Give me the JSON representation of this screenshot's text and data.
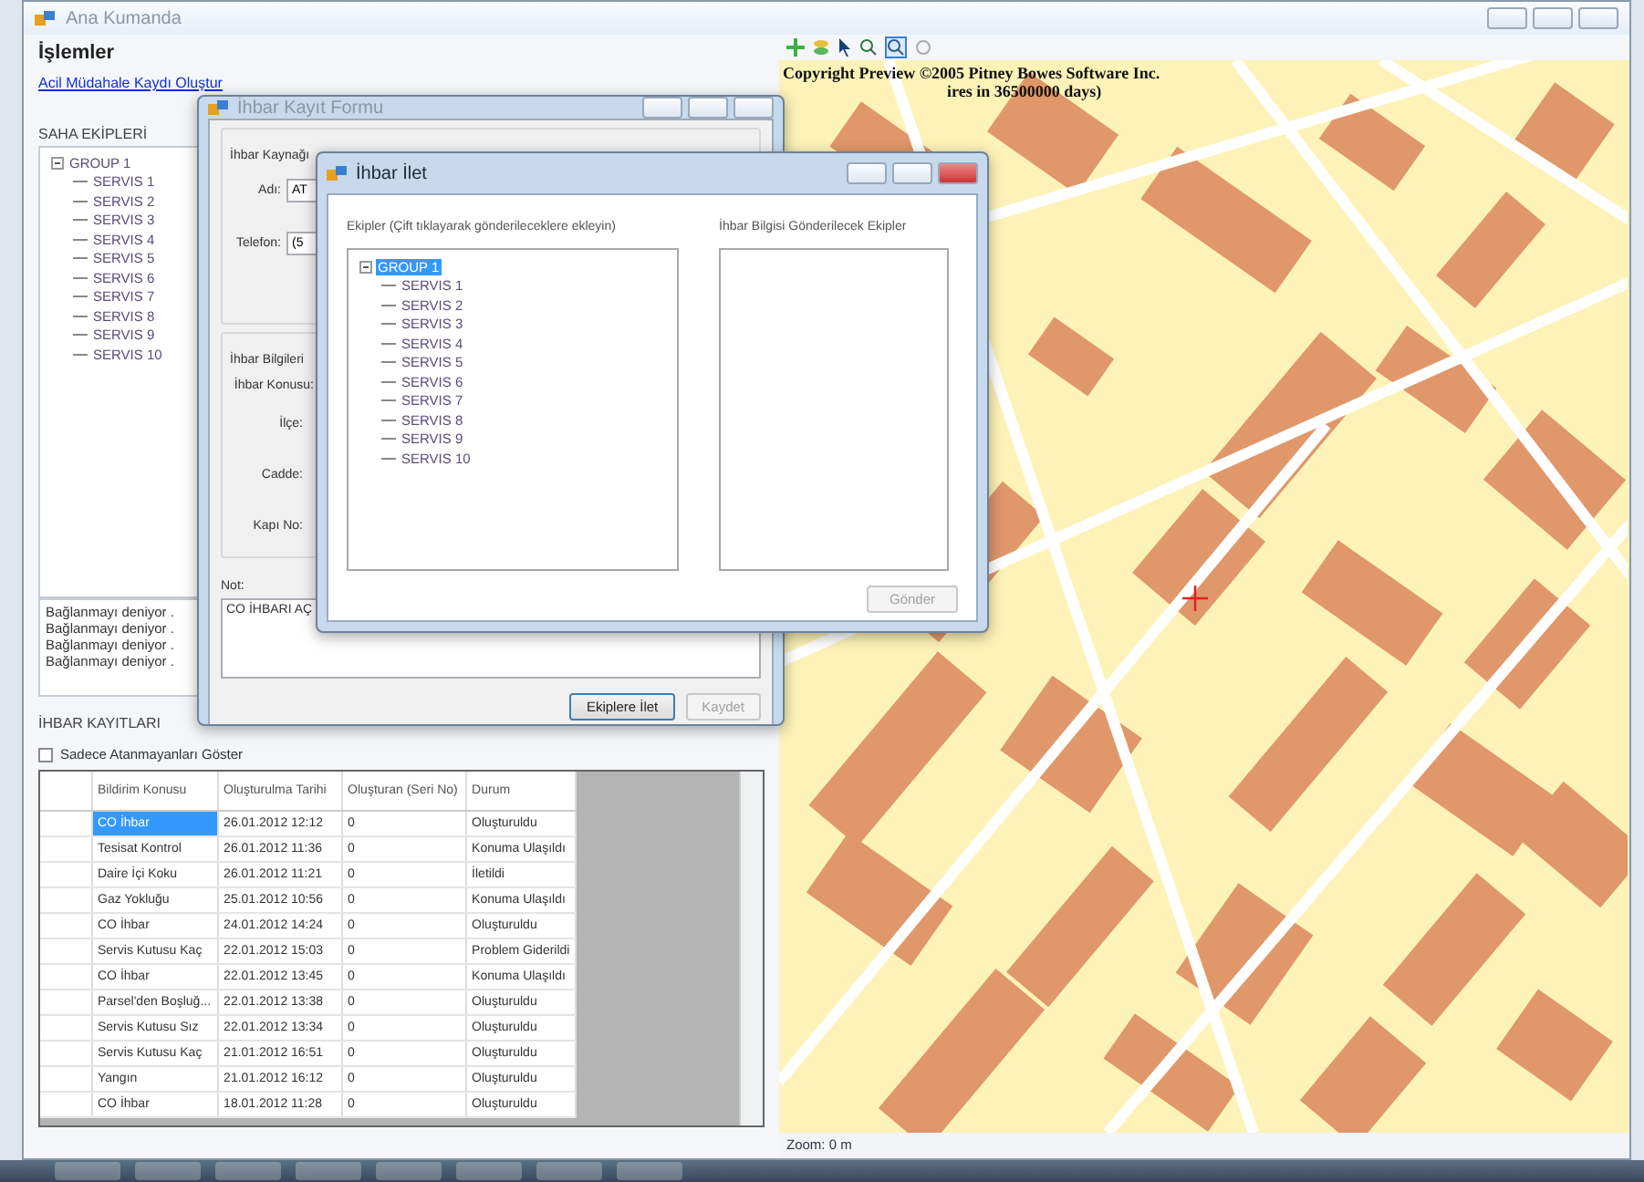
{
  "window": {
    "title": "Ana Kumanda"
  },
  "sidebar": {
    "heading": "İşlemler",
    "link": "Acil Müdahale Kaydı Oluştur",
    "teams_heading": "SAHA EKİPLERİ",
    "tree": [
      {
        "label": "GROUP 1",
        "expanded": true,
        "children": [
          {
            "label": "SERVIS 1"
          },
          {
            "label": "SERVIS 2"
          },
          {
            "label": "SERVIS 3"
          },
          {
            "label": "SERVIS 4"
          },
          {
            "label": "SERVIS 5"
          },
          {
            "label": "SERVIS 6"
          },
          {
            "label": "SERVIS 7"
          },
          {
            "label": "SERVIS 8"
          },
          {
            "label": "SERVIS 9"
          },
          {
            "label": "SERVIS 10"
          }
        ]
      }
    ],
    "log": [
      "Bağlanmayı deniyor .",
      "Bağlanmayı deniyor .",
      "Bağlanmayı deniyor .",
      "Bağlanmayı deniyor ."
    ]
  },
  "records": {
    "heading": "İHBAR KAYITLARI",
    "filter": {
      "label": "Sadece Atanmayanları Göster",
      "checked": false
    },
    "columns": [
      "Bildirim Konusu",
      "Oluşturulma Tarihi",
      "Oluşturan (Seri No)",
      "Durum"
    ],
    "rows": [
      {
        "cells": [
          "CO İhbar",
          "26.01.2012 12:12",
          "0",
          "Oluşturuldu"
        ],
        "selected": true
      },
      {
        "cells": [
          "Tesisat Kontrol",
          "26.01.2012 11:36",
          "0",
          "Konuma Ulaşıldı"
        ],
        "selected": false
      },
      {
        "cells": [
          "Daire İçi Koku",
          "26.01.2012 11:21",
          "0",
          "İletildi"
        ],
        "selected": false
      },
      {
        "cells": [
          "Gaz Yokluğu",
          "25.01.2012 10:56",
          "0",
          "Konuma Ulaşıldı"
        ],
        "selected": false
      },
      {
        "cells": [
          "CO İhbar",
          "24.01.2012 14:24",
          "0",
          "Oluşturuldu"
        ],
        "selected": false
      },
      {
        "cells": [
          "Servis Kutusu Kaç",
          "22.01.2012 15:03",
          "0",
          "Problem Giderildi"
        ],
        "selected": false
      },
      {
        "cells": [
          "CO İhbar",
          "22.01.2012 13:45",
          "0",
          "Konuma Ulaşıldı"
        ],
        "selected": false
      },
      {
        "cells": [
          "Parsel'den Boşluğ...",
          "22.01.2012 13:38",
          "0",
          "Oluşturuldu"
        ],
        "selected": false
      },
      {
        "cells": [
          "Servis Kutusu Sız",
          "22.01.2012 13:34",
          "0",
          "Oluşturuldu"
        ],
        "selected": false
      },
      {
        "cells": [
          "Servis Kutusu Kaç",
          "21.01.2012 16:51",
          "0",
          "Oluşturuldu"
        ],
        "selected": false
      },
      {
        "cells": [
          "Yangın",
          "21.01.2012 16:12",
          "0",
          "Oluşturuldu"
        ],
        "selected": false
      },
      {
        "cells": [
          "CO İhbar",
          "18.01.2012 11:28",
          "0",
          "Oluşturuldu"
        ],
        "selected": false
      }
    ]
  },
  "map": {
    "copyright": [
      "Copyright Preview ©2005 Pitney Bowes Software Inc.",
      "ires in 36500000 days)"
    ],
    "status": "Zoom: 0 m"
  },
  "form": {
    "title": "İhbar Kayıt Formu",
    "source_heading": "İhbar Kaynağı",
    "fields": [
      {
        "label": "Adı:",
        "value": "AT"
      },
      {
        "label": "Telefon:",
        "value": "(5"
      }
    ],
    "info_heading": "İhbar Bilgileri",
    "info_fields": [
      "İhbar Konusu:",
      "İlçe:",
      "Cadde:",
      "Kapı No:"
    ],
    "note_label": "Not:",
    "note": "CO İHBARI AÇ",
    "buttons": [
      {
        "label": "Ekiplere İlet",
        "disabled": false
      },
      {
        "label": "Kaydet",
        "disabled": true
      }
    ]
  },
  "dialog": {
    "title": "İhbar İlet",
    "left_label": "Ekipler (Çift tıklayarak gönderileceklere ekleyin)",
    "right_label": "İhbar Bilgisi Gönderilecek Ekipler",
    "tree": [
      {
        "label": "GROUP 1",
        "selected": true,
        "expanded": true,
        "children": [
          {
            "label": "SERVIS 1",
            "selected": false
          },
          {
            "label": "SERVIS 2",
            "selected": false
          },
          {
            "label": "SERVIS 3",
            "selected": false
          },
          {
            "label": "SERVIS 4",
            "selected": false
          },
          {
            "label": "SERVIS 5",
            "selected": false
          },
          {
            "label": "SERVIS 6",
            "selected": false
          },
          {
            "label": "SERVIS 7",
            "selected": false
          },
          {
            "label": "SERVIS 8",
            "selected": false
          },
          {
            "label": "SERVIS 9",
            "selected": false
          },
          {
            "label": "SERVIS 10",
            "selected": false
          }
        ]
      }
    ],
    "send": {
      "label": "Gönder",
      "disabled": true
    }
  }
}
